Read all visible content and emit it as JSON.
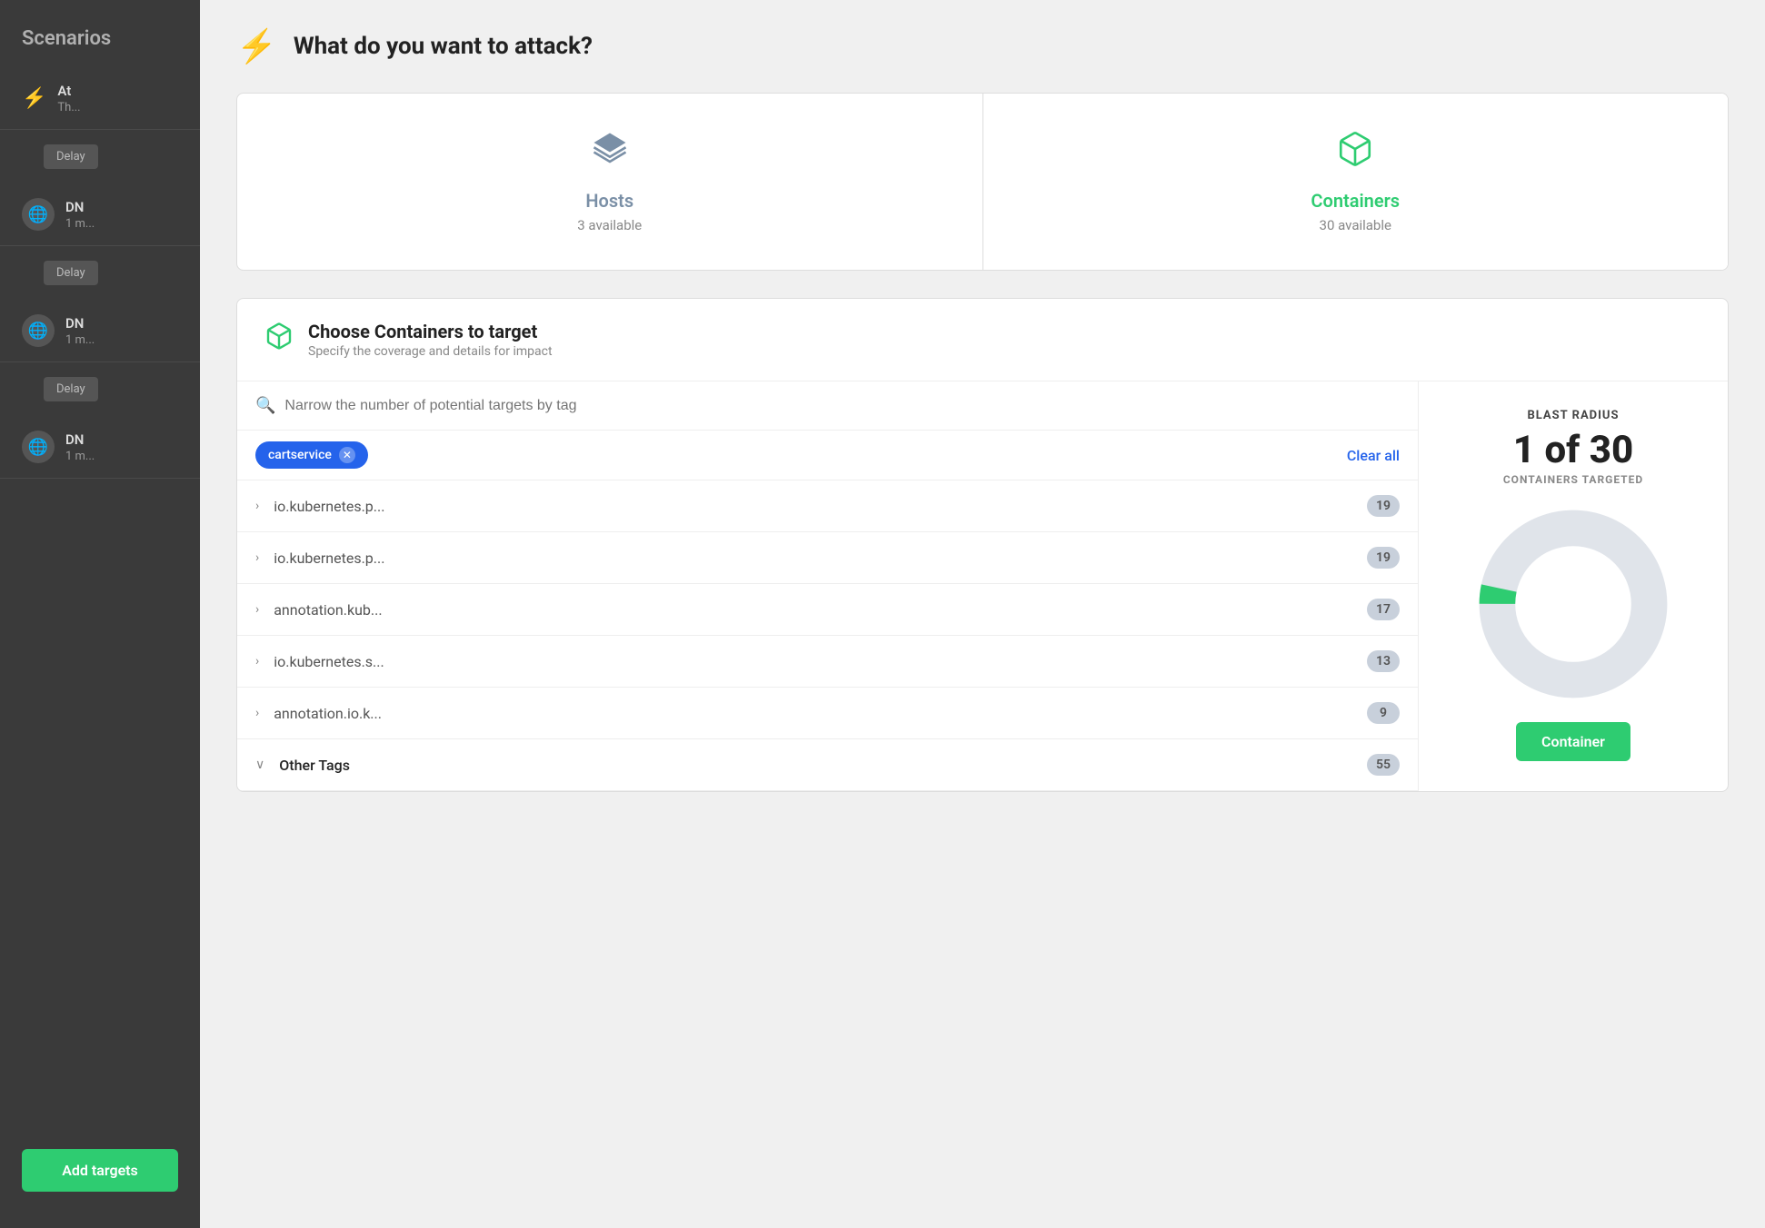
{
  "sidebar": {
    "title": "Scenarios",
    "items": [
      {
        "id": "item1",
        "icon": "bolt",
        "name": "At",
        "sub": "Th..."
      },
      {
        "id": "delay1",
        "type": "delay",
        "label": "Delay"
      },
      {
        "id": "item2",
        "icon": "globe",
        "name": "DN",
        "sub": "1 m..."
      },
      {
        "id": "delay2",
        "type": "delay",
        "label": "Delay"
      },
      {
        "id": "item3",
        "icon": "globe",
        "name": "DN",
        "sub": "1 m..."
      },
      {
        "id": "delay3",
        "type": "delay",
        "label": "Delay"
      },
      {
        "id": "item4",
        "icon": "globe",
        "name": "DN",
        "sub": "1 m..."
      }
    ],
    "add_button": "Add targets"
  },
  "header": {
    "icon": "bolt",
    "title": "What do you want to attack?"
  },
  "target_cards": [
    {
      "id": "hosts",
      "icon": "layers",
      "name": "Hosts",
      "count": "3 available",
      "active": false
    },
    {
      "id": "containers",
      "icon": "cube",
      "name": "Containers",
      "count": "30 available",
      "active": true
    }
  ],
  "choose_section": {
    "icon": "cube",
    "title": "Choose Containers to target",
    "subtitle": "Specify the coverage and details for impact"
  },
  "search": {
    "placeholder": "Narrow the number of potential targets by tag"
  },
  "active_tags": [
    {
      "label": "cartservice"
    }
  ],
  "clear_all_label": "Clear all",
  "tag_rows": [
    {
      "name": "io.kubernetes.p...",
      "count": "19",
      "expanded": false
    },
    {
      "name": "io.kubernetes.p...",
      "count": "19",
      "expanded": false
    },
    {
      "name": "annotation.kub...",
      "count": "17",
      "expanded": false
    },
    {
      "name": "io.kubernetes.s...",
      "count": "13",
      "expanded": false
    },
    {
      "name": "annotation.io.k...",
      "count": "9",
      "expanded": false
    },
    {
      "name": "Other Tags",
      "count": "55",
      "expanded": true,
      "other": true
    }
  ],
  "blast_radius": {
    "title": "BLAST RADIUS",
    "count": "1 of 30",
    "label": "CONTAINERS TARGETED",
    "donut": {
      "total": 30,
      "selected": 1,
      "color_selected": "#2ecc71",
      "color_rest": "#e0e4ea"
    },
    "button_label": "Container"
  }
}
